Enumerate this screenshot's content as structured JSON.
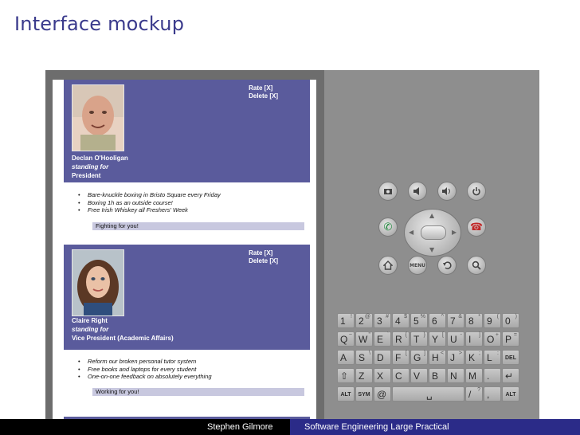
{
  "slide": {
    "title": "Interface mockup"
  },
  "colors": {
    "title": "#3a3a8c",
    "card_header": "#5a5b9c",
    "slogan_bar": "#c8c8df",
    "footer_left_bg": "#000000",
    "footer_right_bg": "#2b2b88"
  },
  "candidates": [
    {
      "actions": [
        "Rate [X]",
        "Delete [X]"
      ],
      "name": "Declan O'Hooligan",
      "role_intro": "standing for",
      "role": "President",
      "bullets": [
        "Bare-knuckle boxing in Bristo Square every Friday",
        "Boxing 1h as an outside course!",
        "Free Irish Whiskey all Freshers' Week"
      ],
      "slogan": "Fighting for you!"
    },
    {
      "actions": [
        "Rate [X]",
        "Delete [X]"
      ],
      "name": "Claire Right",
      "role_intro": "standing for",
      "role": "Vice President (Academic Affairs)",
      "bullets": [
        "Reform our broken personal tutor system",
        "Free books and laptops for every student",
        "One-on-one feedback on absolutely everything"
      ],
      "slogan": "Working for you!"
    }
  ],
  "controls": {
    "top_icons": [
      "camera-icon",
      "volume-down-icon",
      "volume-up-icon",
      "power-icon"
    ],
    "call_icons": [
      "call-icon",
      "end-call-icon"
    ],
    "bottom_icons": [
      "home-icon",
      "menu-icon",
      "back-icon",
      "search-icon"
    ],
    "menu_label": "MENU"
  },
  "keyboard": {
    "row1": [
      [
        "1",
        "!"
      ],
      [
        "2",
        "@"
      ],
      [
        "3",
        "#"
      ],
      [
        "4",
        "$"
      ],
      [
        "5",
        "%"
      ],
      [
        "6",
        "^"
      ],
      [
        "7",
        "&"
      ],
      [
        "8",
        "*"
      ],
      [
        "9",
        "("
      ],
      [
        "0",
        ")"
      ]
    ],
    "row2": [
      [
        "Q",
        "~"
      ],
      [
        "W",
        "\""
      ],
      [
        "E",
        "`"
      ],
      [
        "R",
        "{"
      ],
      [
        "T",
        "}"
      ],
      [
        "Y",
        "["
      ],
      [
        "U",
        "-"
      ],
      [
        "I",
        "]"
      ],
      [
        "O",
        "+"
      ],
      [
        "P",
        "="
      ]
    ],
    "row3": [
      [
        "A",
        ""
      ],
      [
        "S",
        "\\"
      ],
      [
        "D",
        ""
      ],
      [
        "F",
        "["
      ],
      [
        "G",
        "]"
      ],
      [
        "H",
        "<"
      ],
      [
        "J",
        ">"
      ],
      [
        "K",
        ";"
      ],
      [
        "L",
        ":"
      ],
      [
        "DEL",
        ""
      ]
    ],
    "row4": [
      [
        "⇧",
        ""
      ],
      [
        "Z",
        ""
      ],
      [
        "X",
        ""
      ],
      [
        "C",
        ""
      ],
      [
        "V",
        ""
      ],
      [
        "B",
        ""
      ],
      [
        "N",
        ""
      ],
      [
        "M",
        ""
      ],
      [
        ".",
        ""
      ],
      [
        "↵",
        ""
      ]
    ],
    "row5": [
      [
        "ALT",
        ""
      ],
      [
        "SYM",
        ""
      ],
      [
        "@",
        ""
      ],
      [
        "␣",
        ""
      ],
      [
        "/",
        "?"
      ],
      [
        ",",
        ""
      ],
      [
        "ALT",
        ""
      ]
    ]
  },
  "footer": {
    "author": "Stephen Gilmore",
    "course": "Software Engineering Large Practical"
  }
}
